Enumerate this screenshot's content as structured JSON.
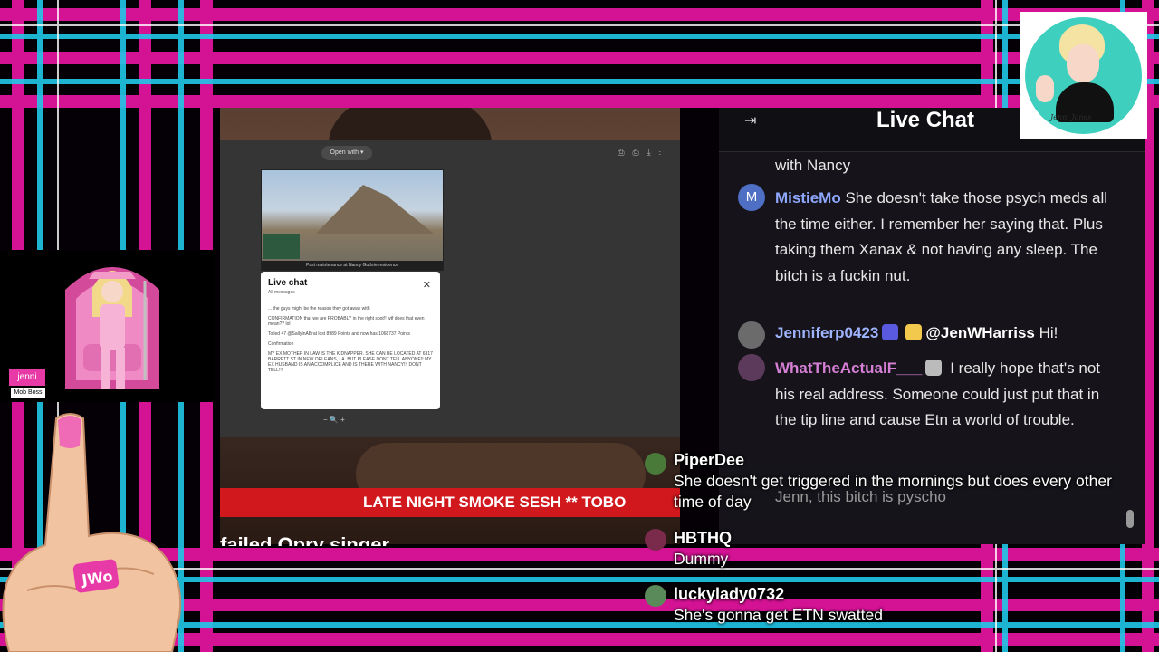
{
  "background": {
    "colors": {
      "magenta": "#e0149c",
      "cyan": "#20c8e8",
      "dark": "#050006"
    }
  },
  "video": {
    "ticker_text": "LATE NIGHT SMOKE SESH ** TOBO",
    "subtitle_text": "failed Opry singer",
    "pdf_viewer": {
      "open_with_label": "Open with ▾",
      "thumbnail_caption": "Past maintenance at Nancy Guthrie residence",
      "mini_chat": {
        "title": "Live chat",
        "subtitle": "All messages",
        "lines": [
          "... the guys might be the reason they got away with",
          "CONFIRMATION that we are PROBABLY in the right spot!! wtf does that even mean?? lol",
          "Tolled 47 @SallyInABrat lost 8989 Points and now has 1068737 Points",
          "Confirmation",
          "MY EX MOTHER IN LAW IS THE KIDNAPPER. SHE CAN BE LOCATED AT 6317 BARRETT ST IN NEW ORLEANS, LA. BUT PLEASE DONT TELL ANYONE!! MY EX HUSBAND IS AN ACCOMPLICE AND IS THERE WITH NANCY!!! DONT TELL!!!"
        ]
      }
    }
  },
  "chat_panel": {
    "title": "Live Chat",
    "messages": [
      {
        "user": "",
        "text": "with Nancy"
      },
      {
        "user": "MistieMo",
        "text": "She doesn't take those psych meds all the time either. I remember her saying that. Plus taking them Xanax & not having any sleep. The bitch is a fuckin nut."
      },
      {
        "user": "Jenniferp0423",
        "mention": "@JenWHarriss",
        "text": "Hi!"
      },
      {
        "user": "WhatTheActualF___",
        "text": "I really hope that's not his real address. Someone could just put that in the tip line and cause Etn a world of trouble."
      }
    ],
    "pinned_text": "Jenn, this bitch is pyscho",
    "colors": {
      "mistiemo": "#8fa8ff",
      "jenniferp": "#9fb4ff",
      "whattheactual": "#d67fd6"
    }
  },
  "overlay_chat": [
    {
      "user": "PiperDee",
      "text": "She doesn't get triggered in the mornings but does every other time of day"
    },
    {
      "user": "HBTHQ",
      "text": "Dummy"
    },
    {
      "user": "luckylady0732",
      "text": "She's gonna get ETN swatted"
    }
  ],
  "streamer_card": {
    "name": "jenni",
    "role": "Mob Boss"
  },
  "logo": {
    "signature": "Jenni Jones"
  },
  "hand_ring_text": "JWo"
}
